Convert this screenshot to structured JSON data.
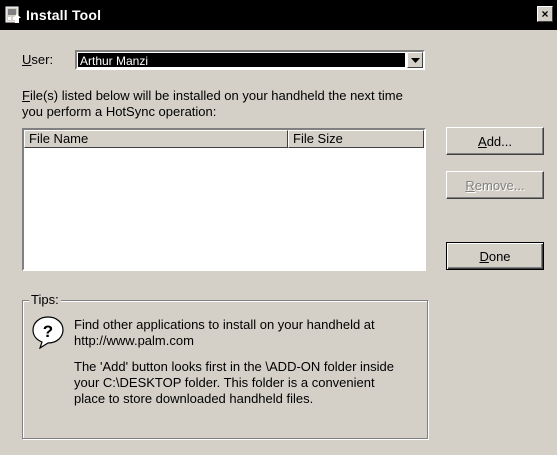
{
  "window": {
    "title": "Install Tool",
    "close_label": "×"
  },
  "user": {
    "label_prefix": "U",
    "label_rest": "ser:",
    "selected": "Arthur Manzi"
  },
  "description": {
    "line1_prefix": "F",
    "line1_rest": "ile(s) listed below will be installed on your handheld the next time",
    "line2": "you perform a HotSync operation:"
  },
  "file_list": {
    "columns": [
      "File Name",
      "File Size"
    ],
    "rows": []
  },
  "buttons": {
    "add_prefix": "A",
    "add_rest": "dd...",
    "remove_prefix": "R",
    "remove_rest": "emove...",
    "done_prefix": "D",
    "done_rest": "one"
  },
  "tips": {
    "label": "Tips:",
    "line1": "Find other applications to install on your handheld at",
    "line2": "http://www.palm.com",
    "para2_line1": "The 'Add' button looks first in the \\ADD-ON folder inside",
    "para2_line2": "your C:\\DESKTOP folder. This folder is a convenient",
    "para2_line3": "place to store downloaded handheld files."
  },
  "icons": {
    "title": "install-tool-icon",
    "tips": "question-icon"
  }
}
